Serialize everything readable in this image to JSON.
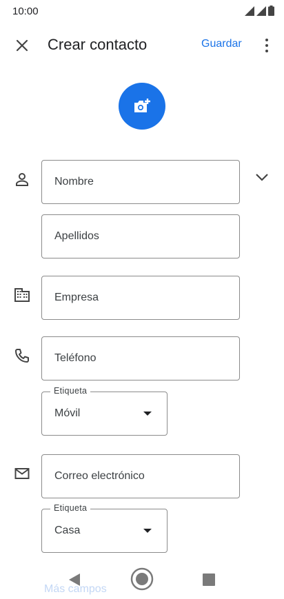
{
  "status_bar": {
    "time": "10:00"
  },
  "header": {
    "title": "Crear contacto",
    "save_label": "Guardar"
  },
  "fields": {
    "nombre": {
      "placeholder": "Nombre"
    },
    "apellidos": {
      "placeholder": "Apellidos"
    },
    "empresa": {
      "placeholder": "Empresa"
    },
    "telefono": {
      "placeholder": "Teléfono"
    },
    "telefono_label": {
      "legend": "Etiqueta",
      "value": "Móvil"
    },
    "correo": {
      "placeholder": "Correo electrónico"
    },
    "correo_label": {
      "legend": "Etiqueta",
      "value": "Casa"
    }
  },
  "more_fields": "Más campos",
  "icons": {
    "close": "close-icon",
    "menu": "more-vert-icon",
    "photo": "add-photo-icon",
    "person": "person-icon",
    "business": "business-icon",
    "phone": "phone-icon",
    "email": "email-icon",
    "expand": "chevron-down-icon"
  },
  "colors": {
    "accent": "#1a73e8",
    "text": "#202124",
    "border": "#8a8a8a"
  }
}
